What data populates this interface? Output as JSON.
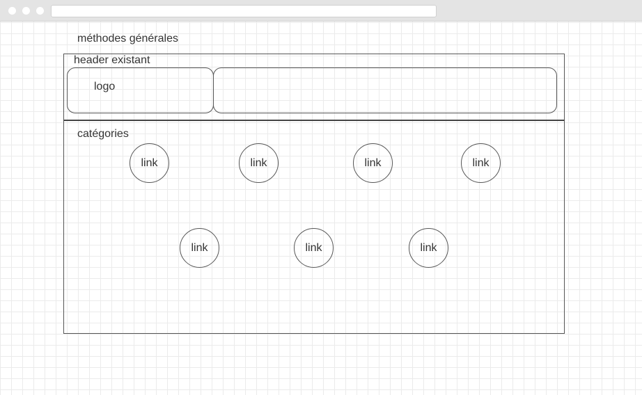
{
  "page_title": "méthodes générales",
  "header": {
    "label": "header existant",
    "logo_label": "logo"
  },
  "categories": {
    "label": "catégories",
    "links": [
      "link",
      "link",
      "link",
      "link",
      "link",
      "link",
      "link"
    ]
  }
}
